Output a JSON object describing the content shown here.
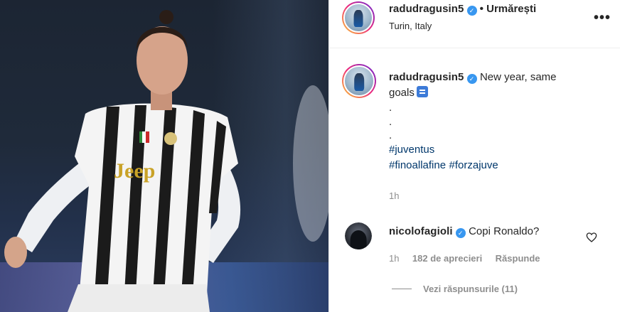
{
  "post": {
    "author": "radudragusin5",
    "follow_label": "Urmărești",
    "separator": "•",
    "location": "Turin, Italy",
    "more_glyph": "•••",
    "verified_glyph": "✓"
  },
  "caption": {
    "author": "radudragusin5",
    "text_line1": "New year, same",
    "text_line2": "goals",
    "dots": [
      ".",
      ".",
      "."
    ],
    "hashtag1": "#juventus",
    "hashtag2": "#finoallafine",
    "hashtag3": "#forzajuve",
    "time": "1h"
  },
  "comment": {
    "author": "nicolofagioli",
    "text": "Copi Ronaldo?",
    "time": "1h",
    "likes": "182 de aprecieri",
    "reply_label": "Răspunde",
    "view_replies": "Vezi răspunsurile (11)"
  },
  "jersey": {
    "sponsor": "Jeep"
  },
  "colors": {
    "verified": "#3897f0",
    "hashtag": "#00376b",
    "muted": "#8e8e8e"
  }
}
